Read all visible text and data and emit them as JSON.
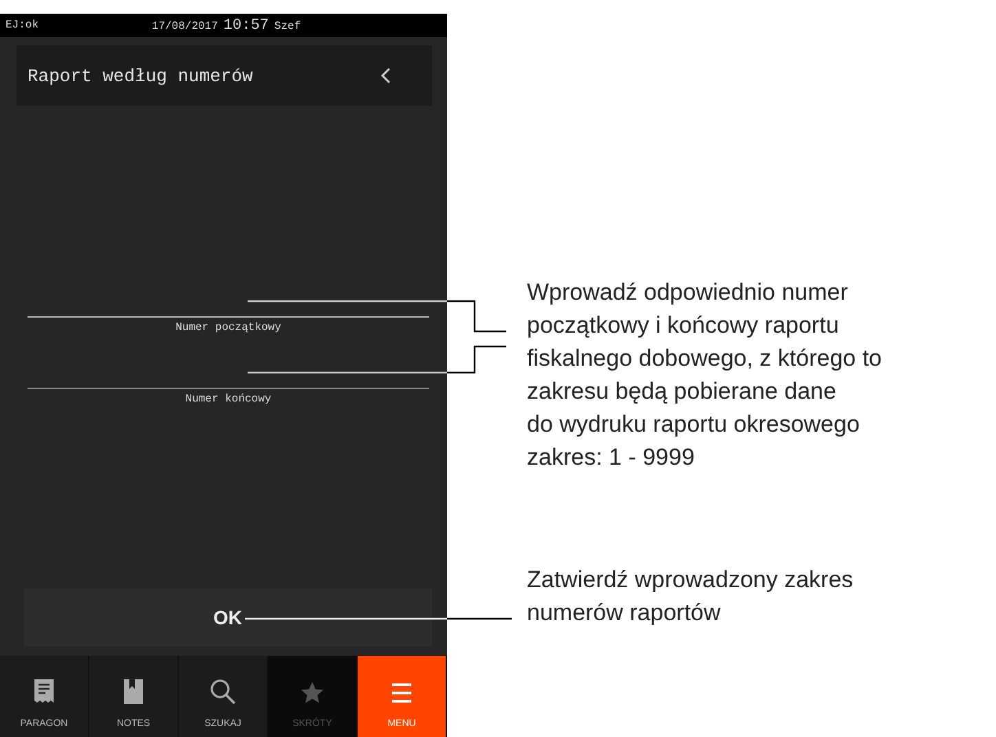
{
  "status_bar": {
    "journal": "EJ:ok",
    "date": "17/08/2017",
    "time": "10:57",
    "user": "Szef"
  },
  "header": {
    "title": "Raport według numerów"
  },
  "fields": [
    {
      "label": "Numer początkowy"
    },
    {
      "label": "Numer końcowy"
    }
  ],
  "ok_button": {
    "label": "OK"
  },
  "nav": [
    {
      "kind": "receipt",
      "label": "PARAGON",
      "selected": false,
      "disabled": false
    },
    {
      "kind": "book",
      "label": "NOTES",
      "selected": false,
      "disabled": false
    },
    {
      "kind": "search",
      "label": "SZUKAJ",
      "selected": false,
      "disabled": false
    },
    {
      "kind": "star",
      "label": "SKRÓTY",
      "selected": false,
      "disabled": true
    },
    {
      "kind": "menu",
      "label": "MENU",
      "selected": true,
      "disabled": false
    }
  ],
  "annotations": [
    "Wprowadź odpowiednio numer\npoczątkowy i końcowy raportu\nfiskalnego dobowego, z którego to\nzakresu będą pobierane dane\ndo wydruku raportu okresowego\nzakres: 1 - 9999",
    "Zatwierdź wprowadzony zakres\nnumerów raportów"
  ]
}
